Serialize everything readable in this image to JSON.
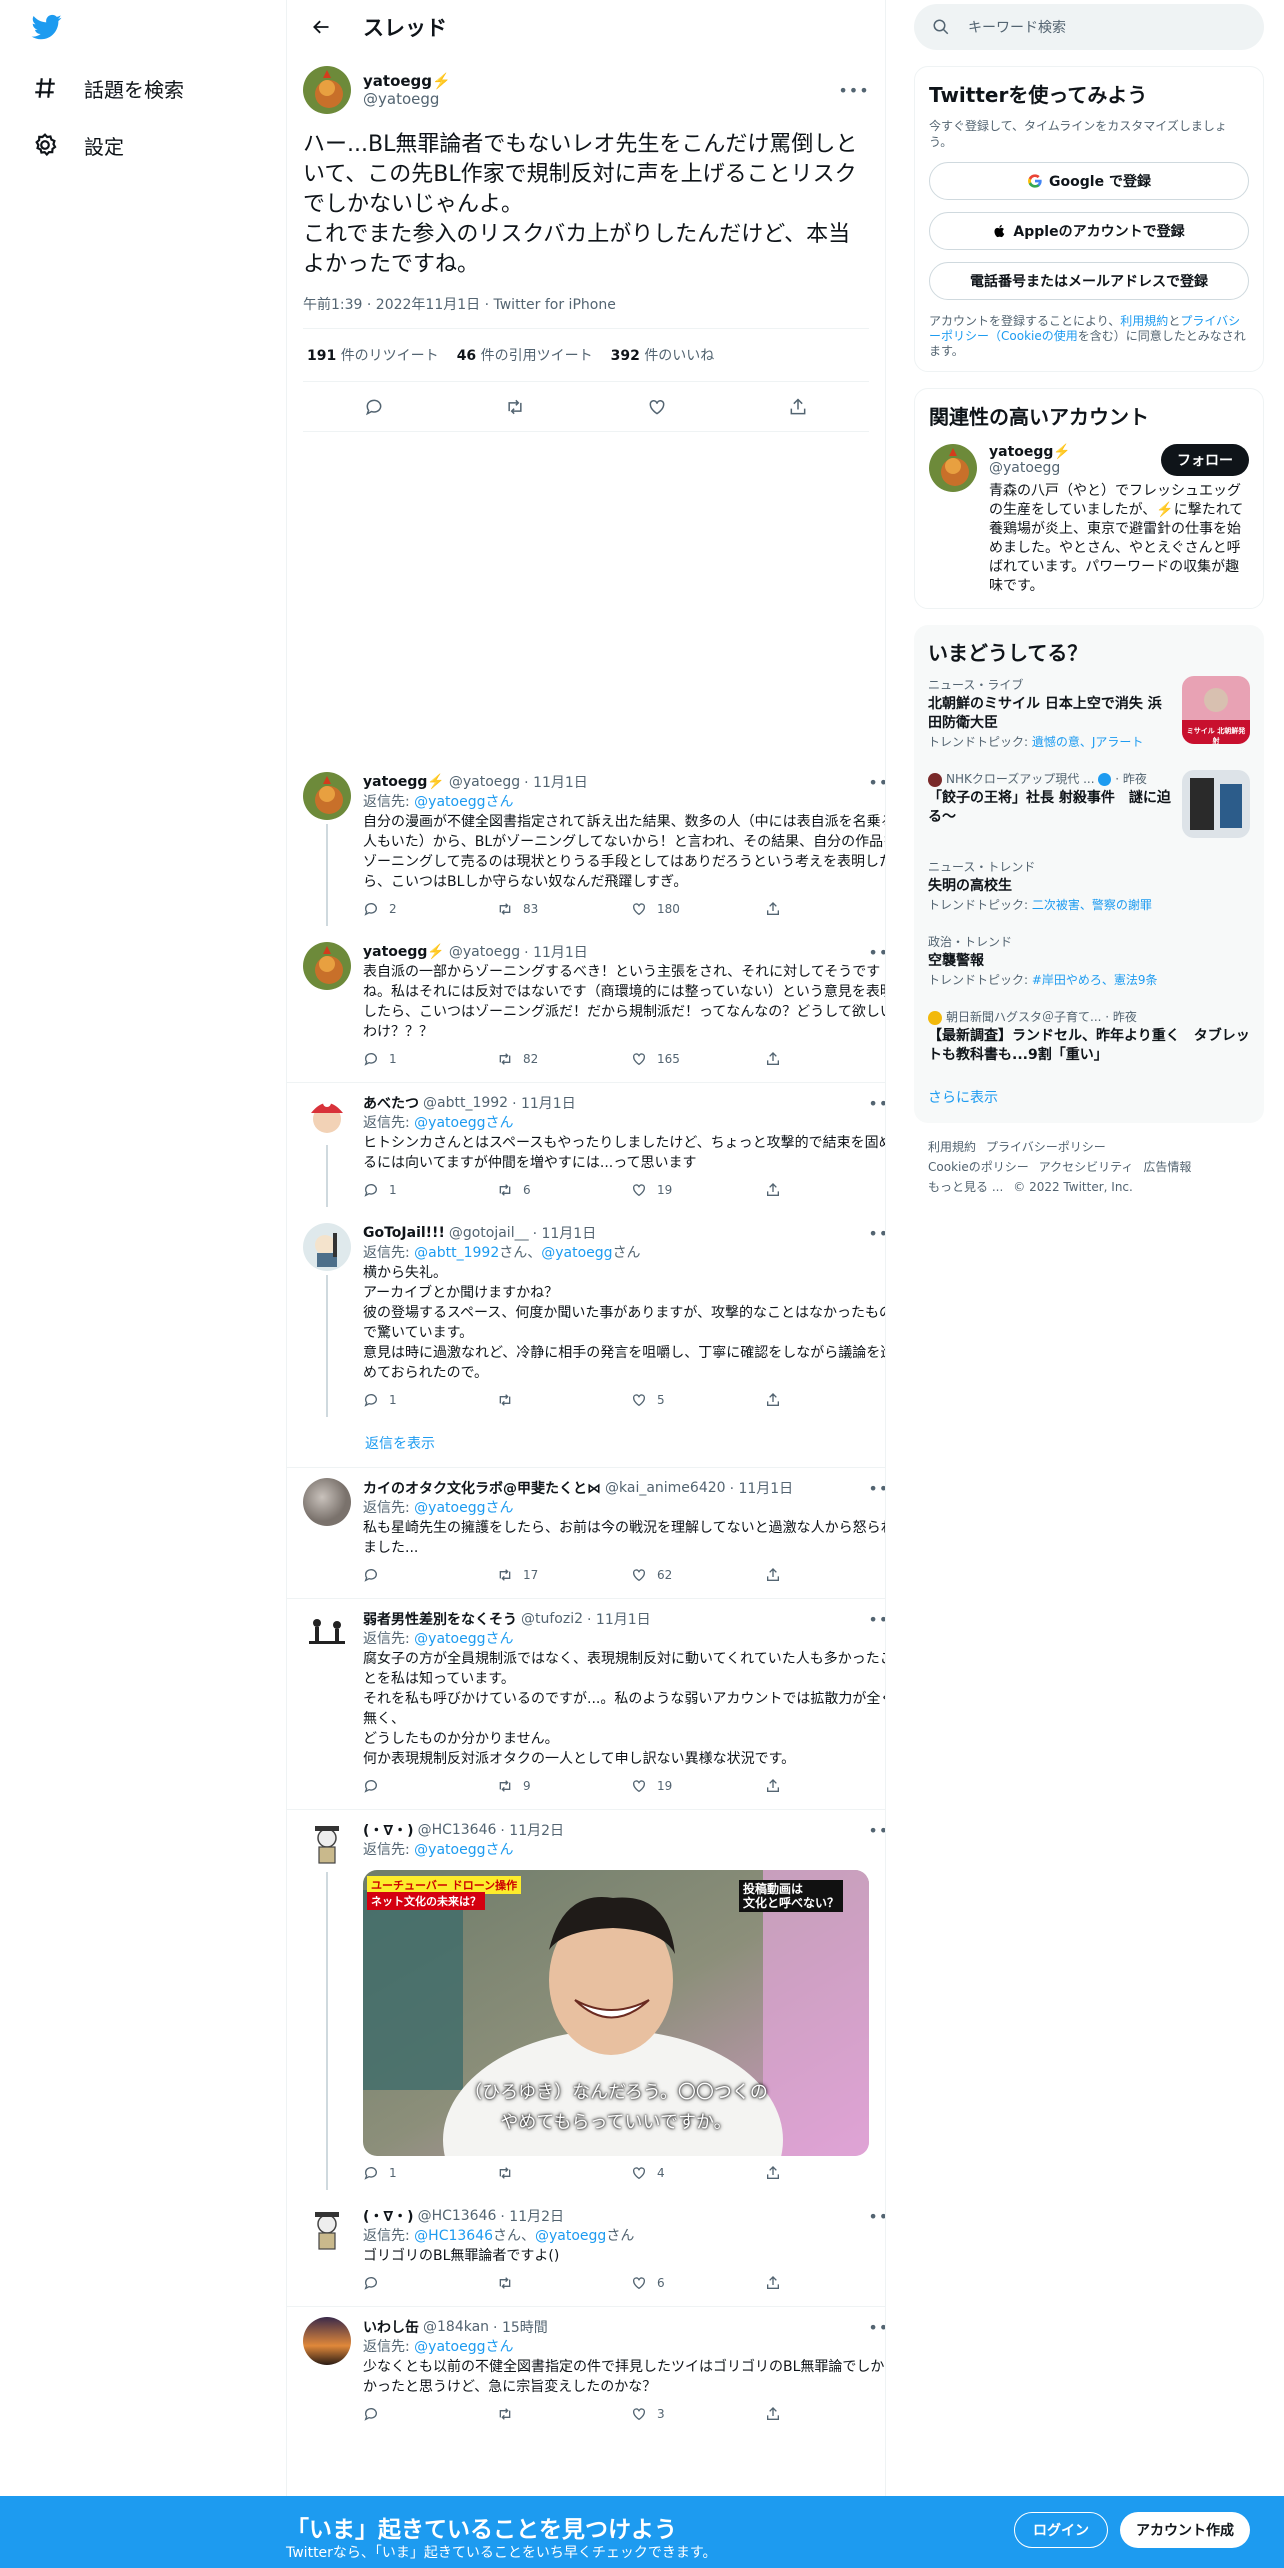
{
  "colors": {
    "brand": "#1d9bf0",
    "text": "#0f1419",
    "muted": "#536471"
  },
  "leftnav": {
    "items": [
      {
        "label": "話題を検索",
        "icon": "hashtag-icon"
      },
      {
        "label": "設定",
        "icon": "gear-icon"
      }
    ]
  },
  "header": {
    "title": "スレッド"
  },
  "main_tweet": {
    "name": "yatoegg⚡️",
    "handle": "@yatoegg",
    "text": "ハー...BL無罪論者でもないレオ先生をこんだけ罵倒しといて、この先BL作家で規制反対に声を上げることリスクでしかないじゃんよ。\nこれでまた参入のリスクバカ上がりしたんだけど、本当よかったですね。",
    "meta": "午前1:39 · 2022年11月1日 · Twitter for iPhone",
    "retweets": "191",
    "retweets_label": "件のリツイート",
    "quotes": "46",
    "quotes_label": "件の引用ツイート",
    "likes": "392",
    "likes_label": "件のいいね"
  },
  "replies": [
    {
      "name": "yatoegg⚡️",
      "handle": "@yatoegg",
      "date": "· 11月1日",
      "reply_prefix": "返信先: ",
      "reply_to": "@yatoeggさん",
      "text": "自分の漫画が不健全図書指定されて訴え出た結果、数多の人（中には表自派を名乗る人もいた）から、BLがゾーニングしてないから！と言われ、その結果、自分の作品をゾーニングして売るのは現状とりうる手段としてはありだろうという考えを表明したら、こいつはBLしか守らない奴なんだ飛躍しすぎ。",
      "reply_count": "2",
      "retweet_count": "83",
      "like_count": "180"
    },
    {
      "name": "yatoegg⚡️",
      "handle": "@yatoegg",
      "date": "· 11月1日",
      "text": "表自派の一部からゾーニングするべき！という主張をされ、それに対してそうですね。私はそれには反対ではないです（商環境的には整っていない）という意見を表明したら、こいつはゾーニング派だ！だから規制派だ！ってなんなの？どうして欲しいわけ？？？",
      "reply_count": "1",
      "retweet_count": "82",
      "like_count": "165"
    },
    {
      "name": "あべたつ",
      "handle": "@abtt_1992",
      "date": "· 11月1日",
      "reply_prefix": "返信先: ",
      "reply_to": "@yatoeggさん",
      "text": "ヒトシンカさんとはスペースもやったりしましたけど、ちょっと攻撃的で結束を固めるには向いてますが仲間を増やすには...って思います",
      "reply_count": "1",
      "retweet_count": "6",
      "like_count": "19"
    },
    {
      "name": "GoToJail!!!",
      "handle": "@gotojail__",
      "date": "· 11月1日",
      "reply_prefix": "返信先: ",
      "reply_to": "@abtt_1992",
      "reply_mid": "さん、",
      "reply_to2": "@yatoegg",
      "reply_suffix": "さん",
      "text": "横から失礼。\nアーカイブとか聞けますかね？\n彼の登場するスペース、何度か聞いた事がありますが、攻撃的なことはなかったもので驚いています。\n意見は時に過激なれど、冷静に相手の発言を咀嚼し、丁寧に確認をしながら議論を進めておられたので。",
      "reply_count": "1",
      "retweet_count": "",
      "like_count": "5"
    },
    {
      "name": "カイのオタク文化ラボ@甲斐たくと⋈",
      "handle": "@kai_anime6420",
      "date": "· 11月1日",
      "reply_prefix": "返信先: ",
      "reply_to": "@yatoeggさん",
      "text": "私も星崎先生の擁護をしたら、お前は今の戦況を理解してないと過激な人から怒られました...",
      "reply_count": "",
      "retweet_count": "17",
      "like_count": "62"
    },
    {
      "name": "弱者男性差別をなくそう",
      "handle": "@tufozi2",
      "date": "· 11月1日",
      "reply_prefix": "返信先: ",
      "reply_to": "@yatoeggさん",
      "text": "腐女子の方が全員規制派ではなく、表現規制反対に動いてくれていた人も多かったことを私は知っています。\nそれを私も呼びかけているのですが...。私のような弱いアカウントでは拡散力が全く無く、\nどうしたものか分かりません。\n何か表現規制反対派オタクの一人として申し訳ない異様な状況です。",
      "reply_count": "",
      "retweet_count": "9",
      "like_count": "19"
    },
    {
      "name": "(・∇・)",
      "handle": "@HC13646",
      "date": "· 11月2日",
      "reply_prefix": "返信先: ",
      "reply_to": "@yatoeggさん",
      "image": {
        "caption_line1": "（ひろゆき）なんだろう。〇〇つくの",
        "caption_line2": "やめてもらっていいですか。",
        "banner_left": "ユーチューバー ドローン操作",
        "banner_left2": "ネット文化の未来は？",
        "banner_right": "投稿動画は\n文化と呼べない？"
      },
      "reply_count": "1",
      "retweet_count": "",
      "like_count": "4"
    },
    {
      "name": "(・∇・)",
      "handle": "@HC13646",
      "date": "· 11月2日",
      "reply_prefix": "返信先: ",
      "reply_to": "@HC13646",
      "reply_mid": "さん、",
      "reply_to2": "@yatoegg",
      "reply_suffix": "さん",
      "text": "ゴリゴリのBL無罪論者ですよ()",
      "reply_count": "",
      "retweet_count": "",
      "like_count": "6"
    },
    {
      "name": "いわし缶",
      "handle": "@184kan",
      "date": "· 15時間",
      "reply_prefix": "返信先: ",
      "reply_to": "@yatoeggさん",
      "text": "少なくとも以前の不健全図書指定の件で拝見したツイはゴリゴリのBL無罪論でしかなかったと思うけど、急に宗旨変えしたのかな？",
      "reply_count": "",
      "retweet_count": "",
      "like_count": "3"
    }
  ],
  "show_replies": "返信を表示",
  "right": {
    "search_placeholder": "キーワード検索",
    "signup_card": {
      "title": "Twitterを使ってみよう",
      "sub": "今すぐ登録して、タイムラインをカスタマイズしましょう。",
      "google": "Google で登録",
      "apple": "Appleのアカウントで登録",
      "phone": "電話番号またはメールアドレスで登録",
      "terms_prefix": "アカウントを登録することにより、",
      "terms_link1": "利用規約",
      "terms_and": "と",
      "terms_link2": "プライバシーポリシー（Cookieの使用",
      "terms_suffix": "を含む）に同意したとみなされます。"
    },
    "related": {
      "title": "関連性の高いアカウント",
      "name": "yatoegg⚡️",
      "handle": "@yatoegg",
      "follow": "フォロー",
      "bio": "青森の八戸（やと）でフレッシュエッグの生産をしていましたが、⚡️に撃たれて養鶏場が炎上、東京で避雷針の仕事を始めました。やとさん、やとえぐさんと呼ばれています。パワーワードの収集が趣味です。"
    },
    "trends": {
      "title": "いまどうしてる？",
      "items": [
        {
          "cat": "ニュース・ライブ",
          "title": "北朝鮮のミサイル 日本上空で消失 浜田防衛大臣",
          "topic_prefix": "トレンドトピック: ",
          "topic": "遺憾の意、Jアラート"
        },
        {
          "cat": "NHKクローズアップ現代 ...",
          "cat_time": "· 昨夜",
          "title": "「餃子の王将」社長 射殺事件　謎に迫る～"
        },
        {
          "cat": "ニュース・トレンド",
          "title": "失明の高校生",
          "topic_prefix": "トレンドトピック: ",
          "topic": "二次被害、警察の謝罪"
        },
        {
          "cat": "政治・トレンド",
          "title": "空襲警報",
          "topic_prefix": "トレンドトピック: ",
          "topic": "#岸田やめろ、憲法9条"
        },
        {
          "cat": "朝日新聞ハグスタ＠子育て...",
          "cat_time": "· 昨夜",
          "title": "【最新調査】ランドセル、昨年より重く　タブレットも教科書も...9割「重い」"
        }
      ],
      "thumb1_text": "ミサイル 北朝鮮発射",
      "more": "さらに表示"
    },
    "footer": {
      "links": [
        "利用規約",
        "プライバシーポリシー",
        "Cookieのポリシー",
        "アクセシビリティ",
        "広告情報",
        "もっと見る ...",
        "© 2022 Twitter, Inc."
      ]
    }
  },
  "bottombar": {
    "title": "「いま」起きていることを見つけよう",
    "sub": "Twitterなら、「いま」起きていることをいち早くチェックできます。",
    "login": "ログイン",
    "signup": "アカウント作成"
  }
}
